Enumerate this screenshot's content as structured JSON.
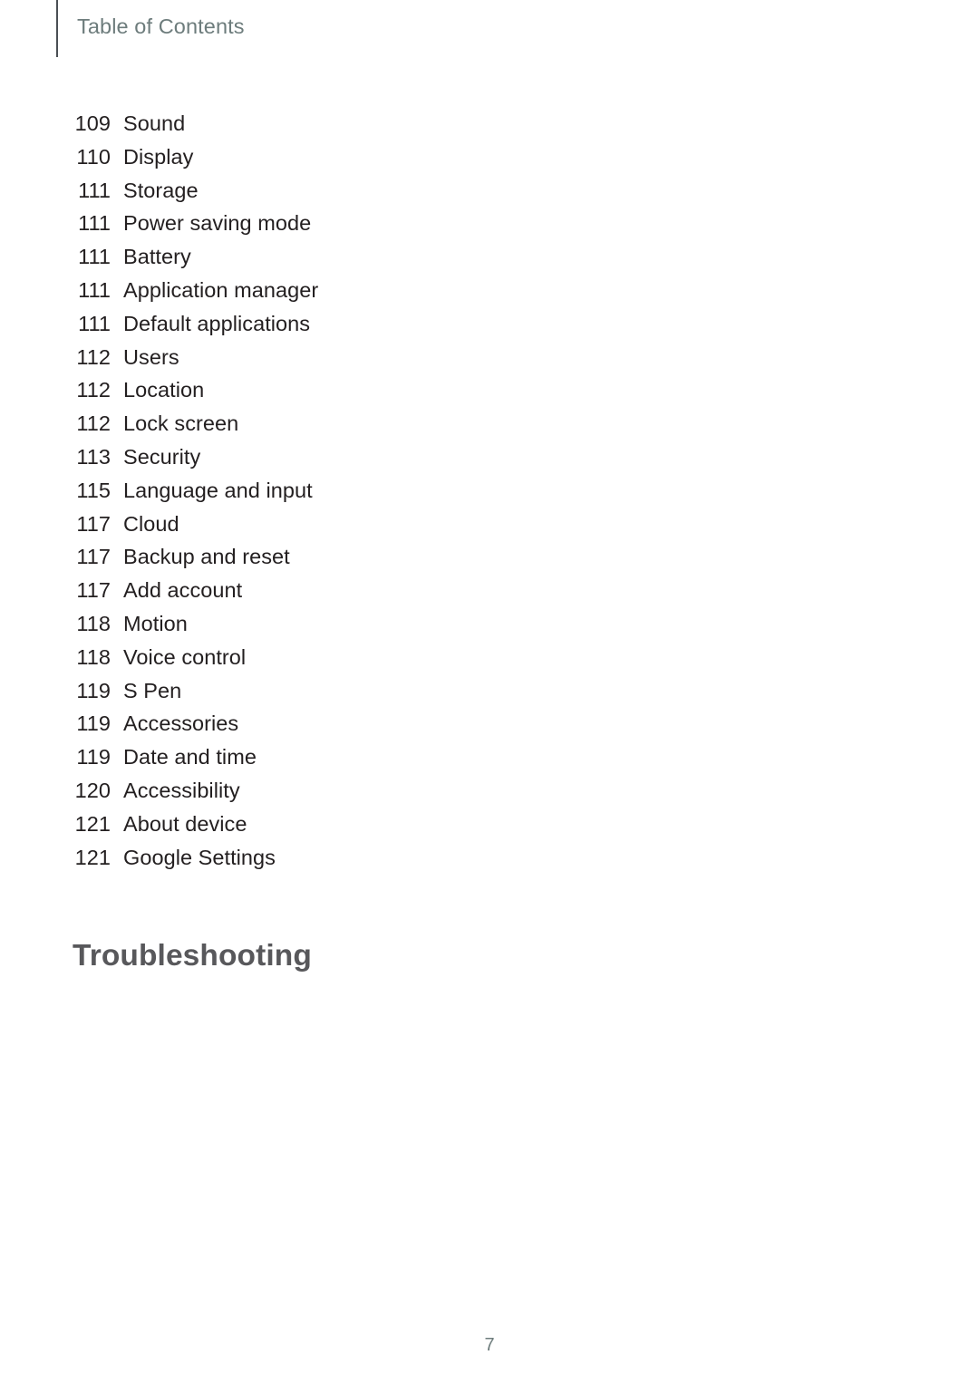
{
  "header": {
    "title": "Table of Contents"
  },
  "toc": {
    "entries": [
      {
        "page": "109",
        "label": "Sound"
      },
      {
        "page": "110",
        "label": "Display"
      },
      {
        "page": "111",
        "label": "Storage"
      },
      {
        "page": "111",
        "label": "Power saving mode"
      },
      {
        "page": "111",
        "label": "Battery"
      },
      {
        "page": "111",
        "label": "Application manager"
      },
      {
        "page": "111",
        "label": "Default applications"
      },
      {
        "page": "112",
        "label": "Users"
      },
      {
        "page": "112",
        "label": "Location"
      },
      {
        "page": "112",
        "label": "Lock screen"
      },
      {
        "page": "113",
        "label": "Security"
      },
      {
        "page": "115",
        "label": "Language and input"
      },
      {
        "page": "117",
        "label": "Cloud"
      },
      {
        "page": "117",
        "label": "Backup and reset"
      },
      {
        "page": "117",
        "label": "Add account"
      },
      {
        "page": "118",
        "label": "Motion"
      },
      {
        "page": "118",
        "label": "Voice control"
      },
      {
        "page": "119",
        "label": "S Pen"
      },
      {
        "page": "119",
        "label": "Accessories"
      },
      {
        "page": "119",
        "label": "Date and time"
      },
      {
        "page": "120",
        "label": "Accessibility"
      },
      {
        "page": "121",
        "label": "About device"
      },
      {
        "page": "121",
        "label": "Google Settings"
      }
    ]
  },
  "chapter": {
    "heading": "Troubleshooting"
  },
  "folio": {
    "number": "7"
  },
  "colors": {
    "header_text": "#6d7c7c",
    "header_rule": "#4a4f54",
    "body_text": "#231f20",
    "heading_text": "#58585b",
    "folio_text": "#6d7c7c",
    "background": "#ffffff"
  }
}
